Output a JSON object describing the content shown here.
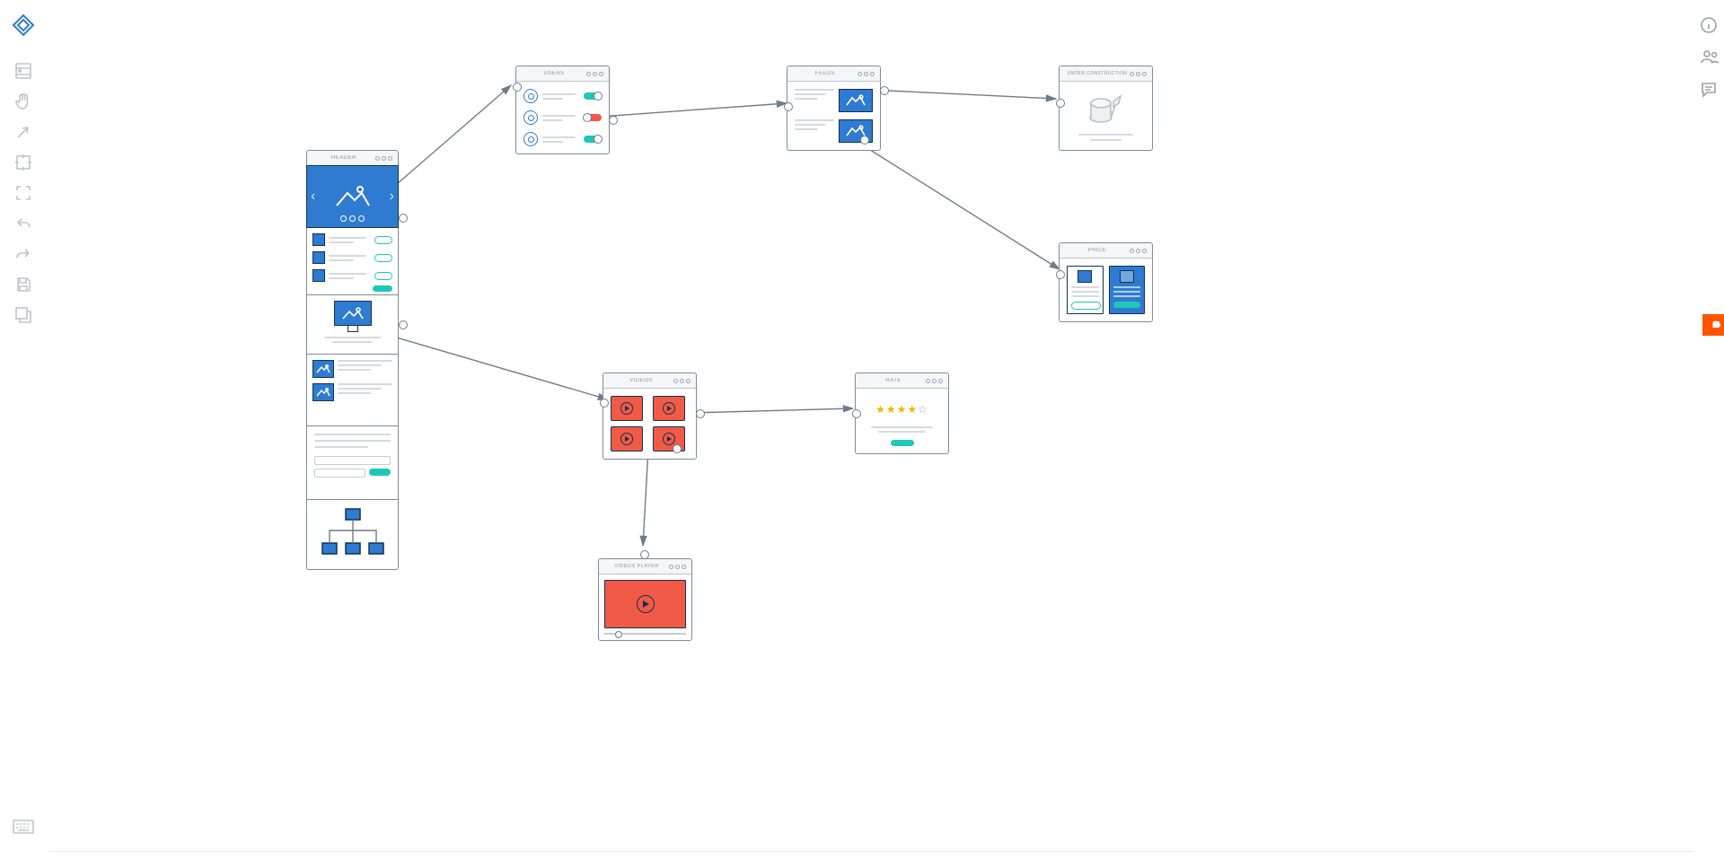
{
  "cards": {
    "header": "HEADER",
    "users": "USERS",
    "feeds": "FEEDS",
    "videos": "VIDEOS",
    "videos_player": "VIDEOS PLAYER",
    "rate": "RATE",
    "price": "PRICE",
    "under_construction": "UNDER CONSTRUCTION"
  },
  "rate": {
    "filled": 4,
    "empty": 1
  },
  "colors": {
    "blue": "#2f7bd1",
    "teal": "#1ec8b7",
    "red": "#f05a46",
    "outline": "#11324f",
    "grey": "#d3dae1"
  }
}
